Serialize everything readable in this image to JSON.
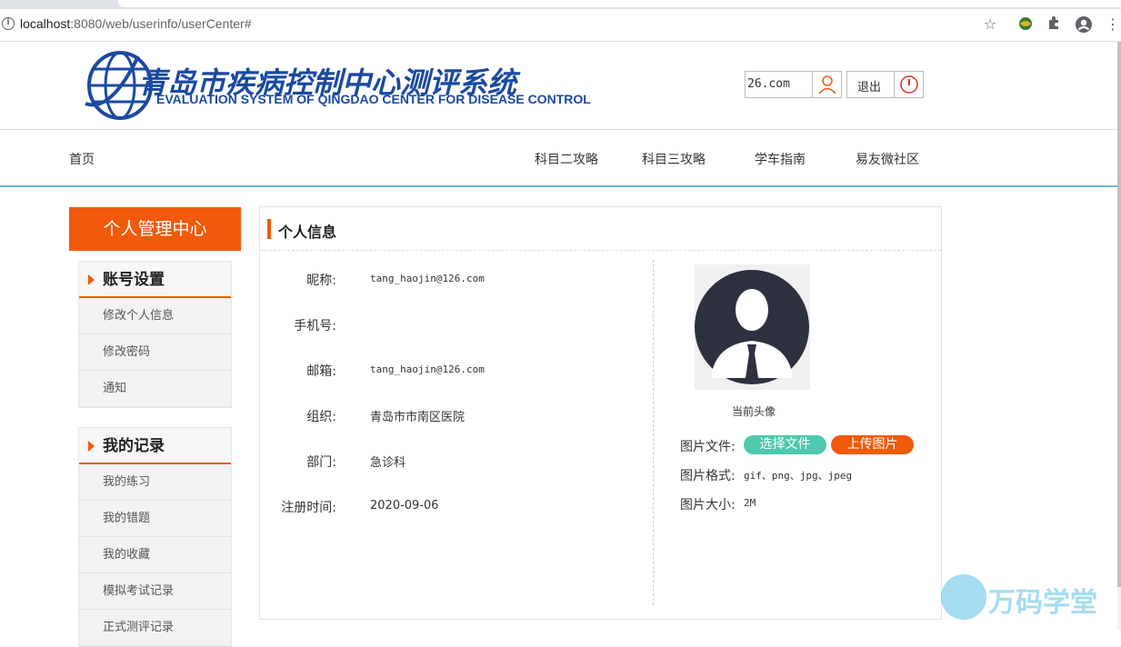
{
  "browser": {
    "url_host": "localhost",
    "url_rest": ":8080/web/userinfo/userCenter#"
  },
  "header": {
    "title": "青岛市疾病控制中心测评系统",
    "subtitle": "EVALUATION SYSTEM OF QINGDAO CENTER FOR DISEASE CONTROL",
    "username": "26.com",
    "logout_label": "退出"
  },
  "nav": {
    "home": "首页",
    "items": [
      "科目二攻略",
      "科目三攻略",
      "学车指南",
      "易友微社区"
    ]
  },
  "sidebar": {
    "heading": "个人管理中心",
    "groups": [
      {
        "title": "账号设置",
        "items": [
          "修改个人信息",
          "修改密码",
          "通知"
        ]
      },
      {
        "title": "我的记录",
        "items": [
          "我的练习",
          "我的错题",
          "我的收藏",
          "模拟考试记录",
          "正式测评记录"
        ]
      }
    ]
  },
  "profile": {
    "title": "个人信息",
    "fields": [
      {
        "label": "昵称:",
        "value": "tang_haojin@126.com"
      },
      {
        "label": "手机号:",
        "value": ""
      },
      {
        "label": "邮箱:",
        "value": "tang_haojin@126.com"
      },
      {
        "label": "组织:",
        "value": "青岛市市南区医院"
      },
      {
        "label": "部门:",
        "value": "急诊科"
      },
      {
        "label": "注册时间:",
        "value": "2020-09-06"
      }
    ],
    "avatar_caption": "当前头像",
    "file_label": "图片文件:",
    "choose_button": "选择文件",
    "upload_button": "上传图片",
    "format_label": "图片格式:",
    "format_value": "gif、png、jpg、jpeg",
    "size_label": "图片大小:",
    "size_value": "2M"
  },
  "watermark": {
    "text": "万码学堂"
  },
  "colors": {
    "accent": "#f05a0a",
    "brand_blue": "#1b4aa0",
    "teal": "#4fc8ad",
    "nav_line": "#6fb8c7"
  }
}
